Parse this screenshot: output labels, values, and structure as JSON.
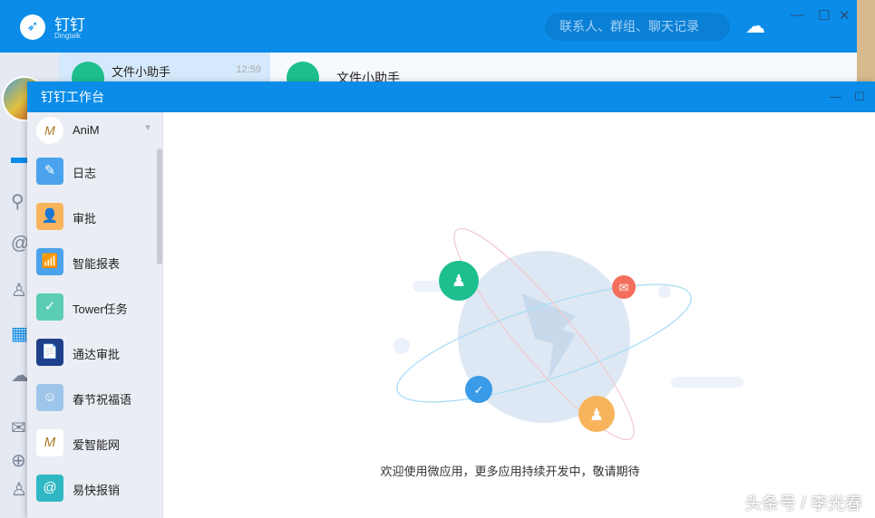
{
  "main": {
    "brand": "钉钉",
    "brand_sub": "Dingtalk",
    "search_placeholder": "联系人、群组、聊天记录",
    "chat": {
      "name": "文件小助手",
      "time": "12:59"
    },
    "conversation_title": "文件小助手"
  },
  "workbench": {
    "title": "钉钉工作台",
    "org": "AniM",
    "apps": [
      {
        "label": "日志",
        "color": "#4aa3ec",
        "icon": "✎"
      },
      {
        "label": "审批",
        "color": "#f7b45a",
        "icon": "👤"
      },
      {
        "label": "智能报表",
        "color": "#4aa3ec",
        "icon": "📶"
      },
      {
        "label": "Tower任务",
        "color": "#5ccdb5",
        "icon": "✓"
      },
      {
        "label": "通达审批",
        "color": "#1e3f8a",
        "icon": "📄"
      },
      {
        "label": "春节祝福语",
        "color": "#9ec5ea",
        "icon": "☺"
      },
      {
        "label": "爱智能网",
        "color": "#ffffff",
        "icon": "M"
      },
      {
        "label": "易快报销",
        "color": "#2fb8c4",
        "icon": "@"
      }
    ],
    "welcome": "欢迎使用微应用，更多应用持续开发中，敬请期待"
  },
  "watermark": "头条号 / 李光春"
}
